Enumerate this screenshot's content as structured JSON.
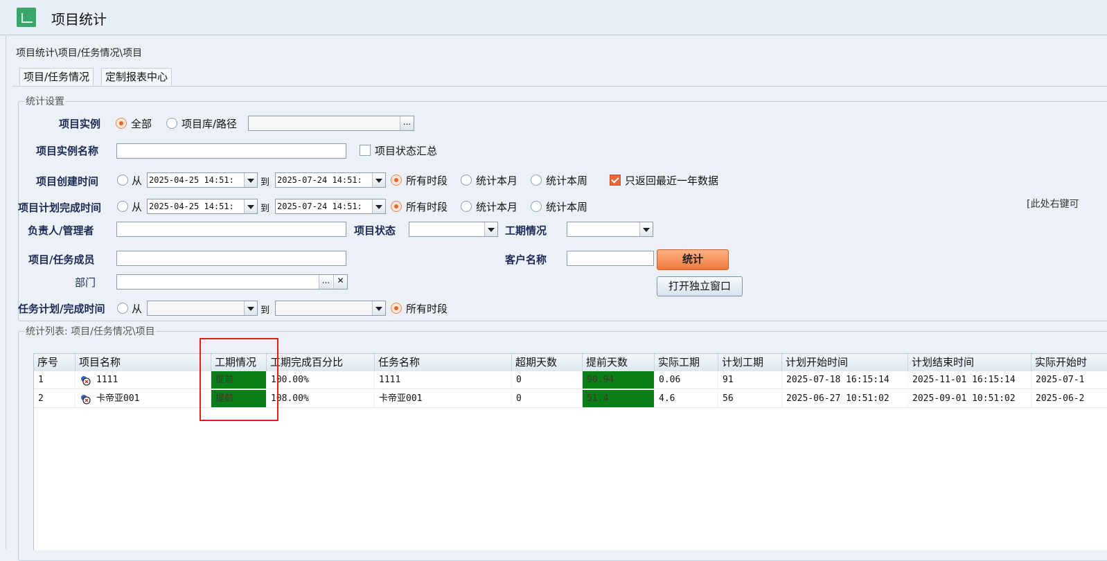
{
  "app": {
    "title": "项目统计",
    "icon": "chart-icon"
  },
  "breadcrumb": "项目统计\\项目/任务情况\\项目",
  "tabs": [
    "项目/任务情况",
    "定制报表中心"
  ],
  "settings": {
    "legend": "统计设置",
    "instance": {
      "label": "项目实例",
      "opt_all": "全部",
      "opt_lib": "项目库/路径",
      "browse": "..."
    },
    "instance_name": {
      "label": "项目实例名称",
      "value": "",
      "summary_label": "项目状态汇总"
    },
    "create_time": {
      "label": "项目创建时间",
      "from": "从",
      "from_value": "2025-04-25 14:51:",
      "to": "到",
      "to_value": "2025-07-24 14:51:",
      "all": "所有时段",
      "month": "统计本月",
      "week": "统计本周",
      "recent_label": "只返回最近一年数据"
    },
    "plan_finish": {
      "label": "项目计划完成时间",
      "from": "从",
      "from_value": "2025-04-25 14:51:",
      "to": "到",
      "to_value": "2025-07-24 14:51:",
      "all": "所有时段",
      "month": "统计本月",
      "week": "统计本周"
    },
    "owner": {
      "label": "负责人/管理者",
      "value": ""
    },
    "status": {
      "label": "项目状态",
      "value": ""
    },
    "duration": {
      "label": "工期情况",
      "value": ""
    },
    "member": {
      "label": "项目/任务成员",
      "value": ""
    },
    "customer": {
      "label": "客户名称",
      "value": ""
    },
    "dept": {
      "label": "部门",
      "value": "",
      "browse": "...",
      "clear": "✕"
    },
    "task_time": {
      "label": "任务计划/完成时间",
      "from": "从",
      "to": "到",
      "all": "所有时段",
      "from_value": "",
      "to_value": ""
    },
    "stat_button": "统计",
    "open_window_button": "打开独立窗口",
    "hint": "[此处右键可"
  },
  "list": {
    "legend": "统计列表: 项目/任务情况\\项目",
    "columns": [
      "序号",
      "项目名称",
      "工期情况",
      "工期完成百分比",
      "任务名称",
      "超期天数",
      "提前天数",
      "实际工期",
      "计划工期",
      "计划开始时间",
      "计划结束时间",
      "实际开始时"
    ],
    "rows": [
      {
        "no": "1",
        "name": "1111",
        "status": "提前",
        "pct": "100.00%",
        "task": "1111",
        "overdue": "0",
        "ahead": "90.94",
        "actual": "0.06",
        "plan": "91",
        "plan_start": "2025-07-18 16:15:14",
        "plan_end": "2025-11-01 16:15:14",
        "actual_start": "2025-07-1"
      },
      {
        "no": "2",
        "name": "卡帝亚001",
        "status": "提前",
        "pct": "108.00%",
        "task": "卡帝亚001",
        "overdue": "0",
        "ahead": "51.4",
        "actual": "4.6",
        "plan": "56",
        "plan_start": "2025-06-27 10:51:02",
        "plan_end": "2025-09-01 10:51:02",
        "actual_start": "2025-06-2"
      }
    ]
  },
  "colors": {
    "accent": "#f07a3c",
    "green": "#0b7f17",
    "highlight": "#e11c1c",
    "radio_on": "#e0672d"
  }
}
